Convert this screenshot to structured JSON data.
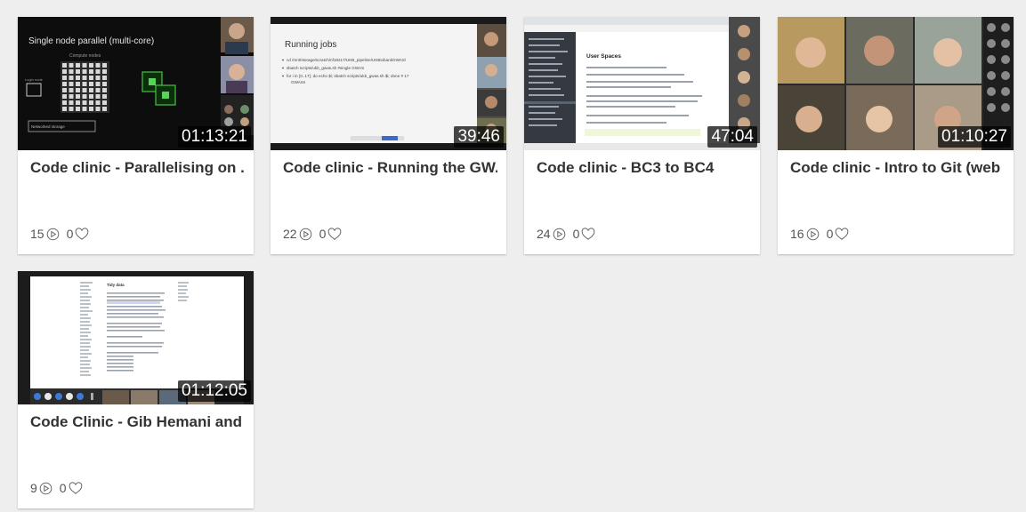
{
  "videos": [
    {
      "title": "Code clinic - Parallelising on ...",
      "duration": "01:13:21",
      "views": "15",
      "likes": "0",
      "slide_title": "Single node parallel (multi-core)",
      "slide_label": "Compute nodes",
      "slide_sub": "Login node",
      "slide_storage": "Networked storage"
    },
    {
      "title": "Code clinic - Running the GW...",
      "duration": "39:46",
      "views": "22",
      "likes": "0",
      "slide_title": "Running jobs",
      "bullets": [
        "cd /mnt/storage/scratch/nf18217/UKB_pipeline/UKBiobankGWAS/",
        "sbatch scripts/ukb_gwas.sh #single GWAS",
        "for i in {0..17}; do echo $i; sbatch scripts/ukb_gwas.sh $i; done # 17",
        "GWASs"
      ]
    },
    {
      "title": "Code clinic - BC3 to BC4",
      "duration": "47:04",
      "views": "24",
      "likes": "0",
      "slide_title": "User Spaces"
    },
    {
      "title": "Code clinic - Intro to Git (web ...",
      "duration": "01:10:27",
      "views": "16",
      "likes": "0"
    },
    {
      "title": "Code Clinic - Gib Hemani and ...",
      "duration": "01:12:05",
      "views": "9",
      "likes": "0",
      "slide_title": "Tidy data"
    }
  ]
}
